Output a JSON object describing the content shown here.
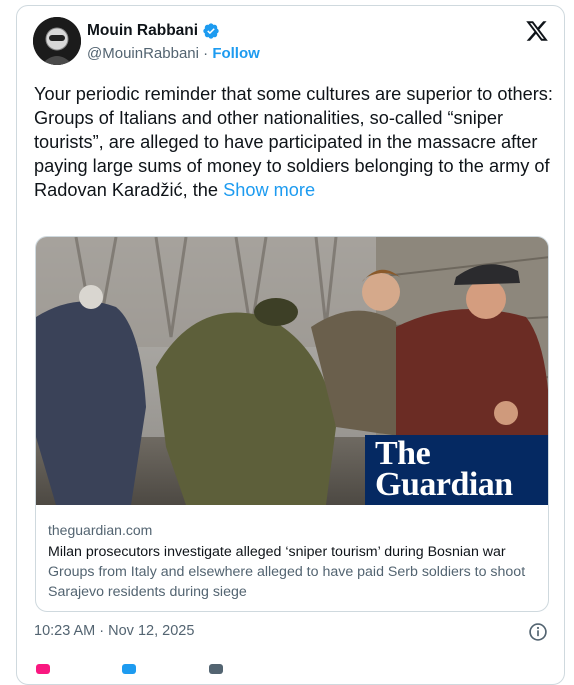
{
  "author": {
    "name": "Mouin Rabbani",
    "handle": "@MouinRabbani",
    "separator": "·",
    "follow_label": "Follow",
    "verified": true
  },
  "tweet": {
    "line1": "Your periodic reminder that some cultures are superior to others:",
    "line2": "Groups of Italians and other nationalities, so-called “sniper tourists”, are alleged to have participated in the massacre after paying large sums of money to soldiers belonging to the army of Radovan Karadžić, the",
    "show_more": "Show more"
  },
  "link_card": {
    "domain": "theguardian.com",
    "headline": "Milan prosecutors investigate alleged ‘sniper tourism’ during Bosnian war",
    "description": "Groups from Italy and elsewhere alleged to have paid Serb soldiers to shoot Sarajevo residents during siege",
    "logo_line1": "The",
    "logo_line2": "Guardian"
  },
  "timestamp": "10:23 AM · Nov 12, 2025",
  "icons": {
    "verified": "verified-badge-icon",
    "platform": "x-logo-icon",
    "info": "info-icon"
  },
  "colors": {
    "accent": "#1d9bf0",
    "guardian_blue": "#052962",
    "secondary_text": "#536471"
  }
}
